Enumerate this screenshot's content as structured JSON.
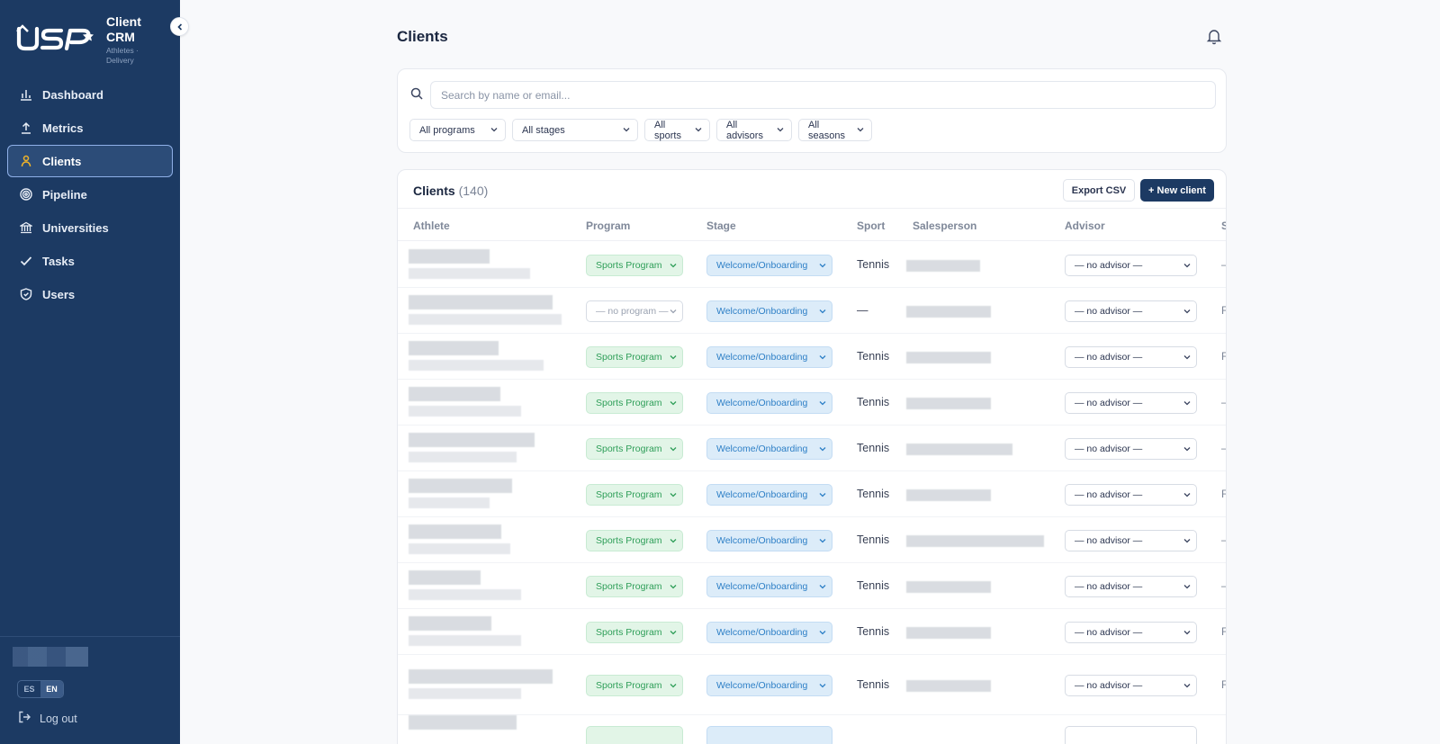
{
  "sidebar": {
    "brand_title": "Client\nCRM",
    "brand_sub": "Athletes ·\nDelivery",
    "items": [
      {
        "label": "Dashboard",
        "icon": "bar-chart-icon"
      },
      {
        "label": "Metrics",
        "icon": "upload-icon"
      },
      {
        "label": "Clients",
        "icon": "person-icon",
        "active": true
      },
      {
        "label": "Pipeline",
        "icon": "target-icon"
      },
      {
        "label": "Universities",
        "icon": "bank-icon"
      },
      {
        "label": "Tasks",
        "icon": "check-icon"
      },
      {
        "label": "Users",
        "icon": "shield-icon"
      }
    ],
    "lang_es": "ES",
    "lang_en": "EN",
    "logout": "Log out"
  },
  "page": {
    "title": "Clients"
  },
  "filters": {
    "search_placeholder": "Search by name or email...",
    "programs": "All programs",
    "stages": "All stages",
    "sports": "All sports",
    "advisors": "All advisors",
    "seasons": "All seasons"
  },
  "table": {
    "title": "Clients",
    "count": "(140)",
    "export_label": "Export CSV",
    "new_label": "+ New client",
    "headers": {
      "athlete": "Athlete",
      "program": "Program",
      "stage": "Stage",
      "sport": "Sport",
      "salesperson": "Salesperson",
      "advisor": "Advisor",
      "last": "S"
    },
    "rows": [
      {
        "program": "Sports Program",
        "stage": "Welcome/Onboarding",
        "sport": "Tennis",
        "advisor": "— no advisor —",
        "last": "–"
      },
      {
        "program": "— no program —",
        "stage": "Welcome/Onboarding",
        "sport": "—",
        "advisor": "— no advisor —",
        "last": "F"
      },
      {
        "program": "Sports Program",
        "stage": "Welcome/Onboarding",
        "sport": "Tennis",
        "advisor": "— no advisor —",
        "last": "F"
      },
      {
        "program": "Sports Program",
        "stage": "Welcome/Onboarding",
        "sport": "Tennis",
        "advisor": "— no advisor —",
        "last": "–"
      },
      {
        "program": "Sports Program",
        "stage": "Welcome/Onboarding",
        "sport": "Tennis",
        "advisor": "— no advisor —",
        "last": "–"
      },
      {
        "program": "Sports Program",
        "stage": "Welcome/Onboarding",
        "sport": "Tennis",
        "advisor": "— no advisor —",
        "last": "F"
      },
      {
        "program": "Sports Program",
        "stage": "Welcome/Onboarding",
        "sport": "Tennis",
        "advisor": "— no advisor —",
        "last": "–"
      },
      {
        "program": "Sports Program",
        "stage": "Welcome/Onboarding",
        "sport": "Tennis",
        "advisor": "— no advisor —",
        "last": "–"
      },
      {
        "program": "Sports Program",
        "stage": "Welcome/Onboarding",
        "sport": "Tennis",
        "advisor": "— no advisor —",
        "last": "F"
      },
      {
        "program": "Sports Program",
        "stage": "Welcome/Onboarding",
        "sport": "Tennis",
        "advisor": "— no advisor —",
        "last": "F"
      }
    ]
  },
  "colors": {
    "sidebar_bg": "#1c3a63",
    "program_green": "#2e9e58",
    "stage_blue": "#2d7fc6",
    "primary_button": "#1c3a63"
  }
}
